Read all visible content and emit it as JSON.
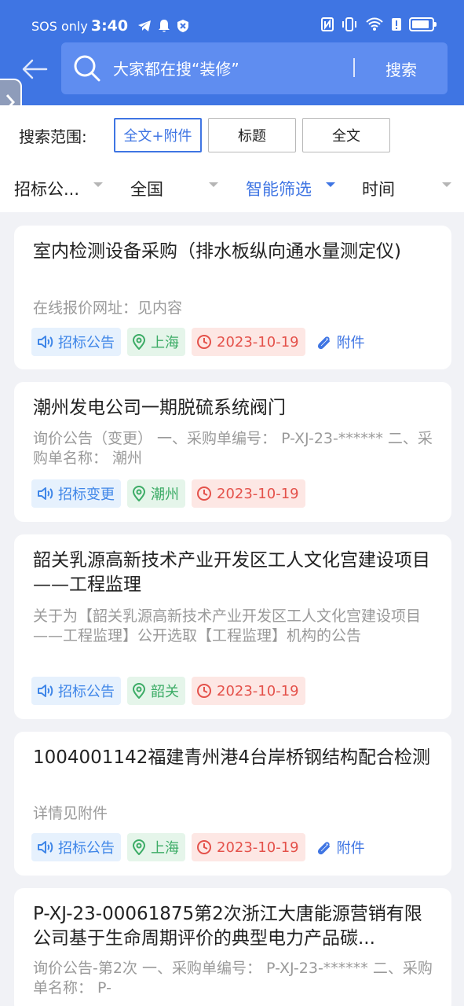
{
  "status_bar": {
    "carrier": "SOS only",
    "time": "3:40"
  },
  "search": {
    "placeholder": "大家都在搜“装修”",
    "button_label": "搜索"
  },
  "scope": {
    "label": "搜索范围:",
    "options": [
      "全文+附件",
      "标题",
      "全文"
    ],
    "selected": "全文+附件"
  },
  "filters": [
    "招标公...",
    "全国",
    "智能筛选",
    "时间"
  ],
  "cards": [
    {
      "title": "室内检测设备采购（排水板纵向通水量测定仪)",
      "desc": "在线报价网址：见内容",
      "type": "招标公告",
      "region": "上海",
      "date": "2023-10-19",
      "attachment": "附件"
    },
    {
      "title": "潮州发电公司一期脱硫系统阀门",
      "desc": "询价公告（变更） 一、采购单编号： P-XJ-23-****** 二、采购单名称： 潮州",
      "type": "招标变更",
      "region": "潮州",
      "date": "2023-10-19"
    },
    {
      "title": "韶关乳源高新技术产业开发区工人文化宫建设项目——工程监理",
      "desc": "关于为【韶关乳源高新技术产业开发区工人文化宫建设项目——工程监理】公开选取【工程监理】机构的公告",
      "type": "招标公告",
      "region": "韶关",
      "date": "2023-10-19"
    },
    {
      "title": "1004001142福建青州港4台岸桥钢结构配合检测",
      "desc": "详情见附件",
      "type": "招标公告",
      "region": "上海",
      "date": "2023-10-19",
      "attachment": "附件"
    },
    {
      "title": "P-XJ-23-00061875第2次浙江大唐能源营销有限公司基于生命周期评价的典型电力产品碳...",
      "desc": "询价公告-第2次 一、采购单编号： P-XJ-23-****** 二、采购单名称： P-"
    }
  ],
  "colors": {
    "primary": "#3f75e3",
    "tag_type": "#3f86e8",
    "tag_region": "#3cac66",
    "tag_date": "#e4514a"
  },
  "icons": [
    "telegram-icon",
    "bell-icon",
    "shield-icon",
    "nfc-icon",
    "vibrate-icon",
    "wifi-icon",
    "battery-icon",
    "back-arrow-icon",
    "search-icon",
    "speaker-icon",
    "location-pin-icon",
    "clock-icon",
    "paperclip-icon"
  ]
}
